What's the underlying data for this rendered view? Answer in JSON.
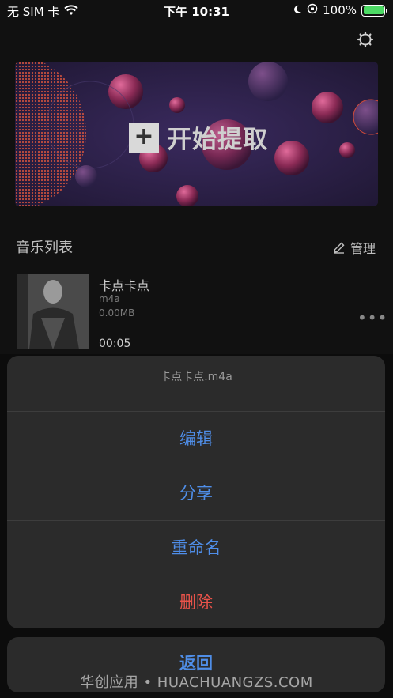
{
  "status_bar": {
    "carrier": "无 SIM 卡",
    "time": "下午 10:31",
    "battery": "100%"
  },
  "banner": {
    "cta_label": "开始提取",
    "plus_symbol": "+"
  },
  "music_list": {
    "title": "音乐列表",
    "manage_label": "管理"
  },
  "track": {
    "title": "卡点卡点",
    "format": "m4a",
    "size": "0.00MB",
    "duration": "00:05",
    "more": "•••"
  },
  "action_sheet": {
    "title": "卡点卡点.m4a",
    "items": [
      {
        "label": "编辑"
      },
      {
        "label": "分享"
      },
      {
        "label": "重命名"
      },
      {
        "label": "删除"
      }
    ],
    "cancel_label": "返回"
  },
  "watermark": "华创应用 • HUACHUANGZS.COM",
  "colors": {
    "action_blue": "#4f8ee8",
    "destructive_red": "#e9534a",
    "battery_green": "#4cd964"
  }
}
